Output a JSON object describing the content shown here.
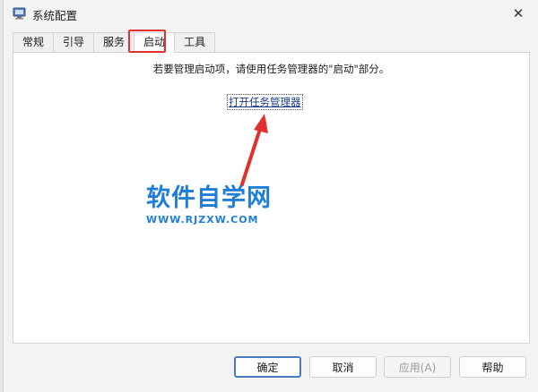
{
  "window": {
    "title": "系统配置",
    "close_symbol": "✕"
  },
  "tabs": [
    {
      "label": "常规"
    },
    {
      "label": "引导"
    },
    {
      "label": "服务"
    },
    {
      "label": "启动",
      "active": true
    },
    {
      "label": "工具"
    }
  ],
  "panel": {
    "instruction": "若要管理启动项，请使用任务管理器的\"启动\"部分。",
    "link_label": "打开任务管理器"
  },
  "watermark": {
    "title": "软件自学网",
    "url": "WWW.RJZXW.COM"
  },
  "buttons": {
    "ok": "确定",
    "cancel": "取消",
    "apply": "应用(A)",
    "help": "帮助"
  },
  "colors": {
    "highlight_box": "#e2302f",
    "link": "#1a3a8a",
    "watermark": "#1f7fd8",
    "primary_border": "#4a7dc0"
  },
  "icons": [
    "msconfig-app-icon",
    "close-icon",
    "red-arrow-annotation"
  ]
}
